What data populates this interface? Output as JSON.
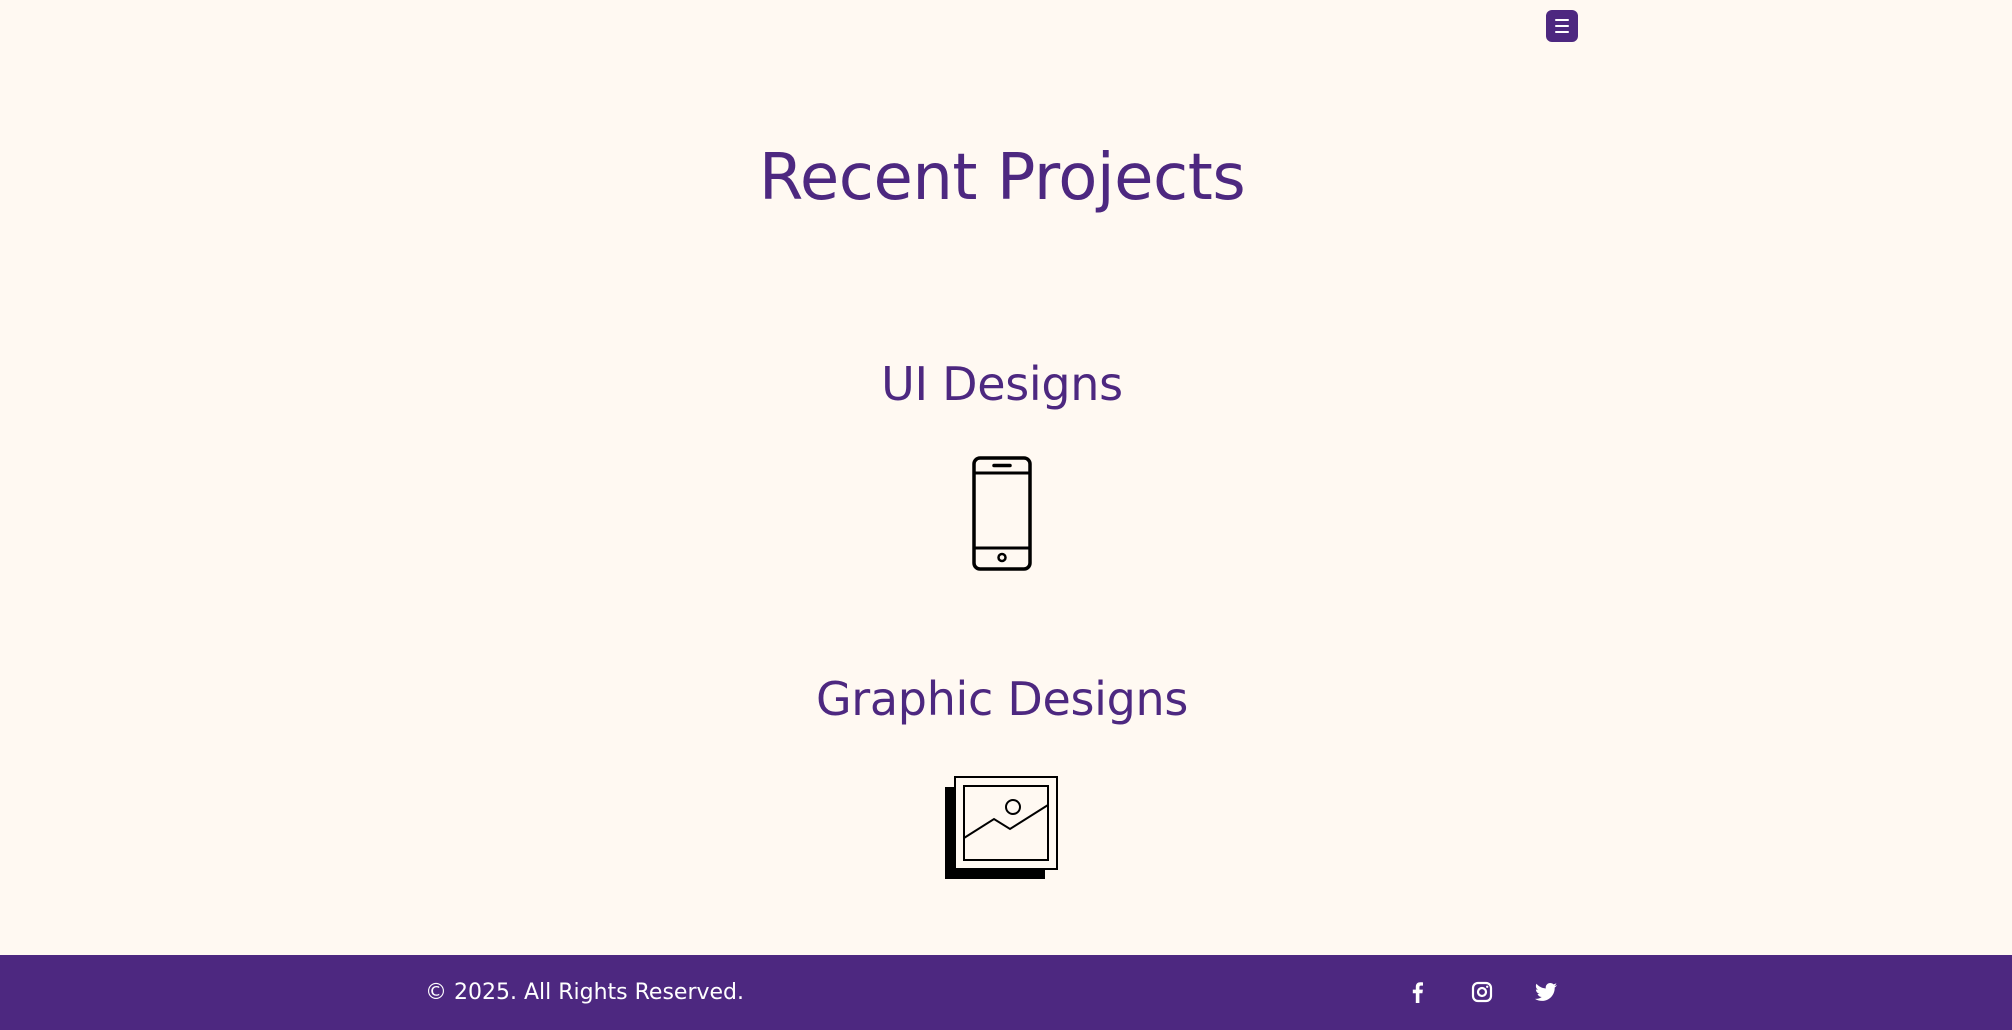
{
  "header": {
    "menu_icon": "hamburger-menu-icon"
  },
  "page": {
    "title": "Recent Projects"
  },
  "projects": [
    {
      "title": "UI Designs",
      "icon": "smartphone-icon"
    },
    {
      "title": "Graphic Designs",
      "icon": "image-gallery-icon"
    }
  ],
  "footer": {
    "copyright": "© 2025. All Rights Reserved.",
    "social": [
      {
        "icon": "facebook-icon"
      },
      {
        "icon": "instagram-icon"
      },
      {
        "icon": "twitter-icon"
      }
    ]
  },
  "colors": {
    "background": "#fff9f2",
    "accent": "#4d2880",
    "text_light": "#ffffff",
    "icon_stroke": "#000000"
  }
}
